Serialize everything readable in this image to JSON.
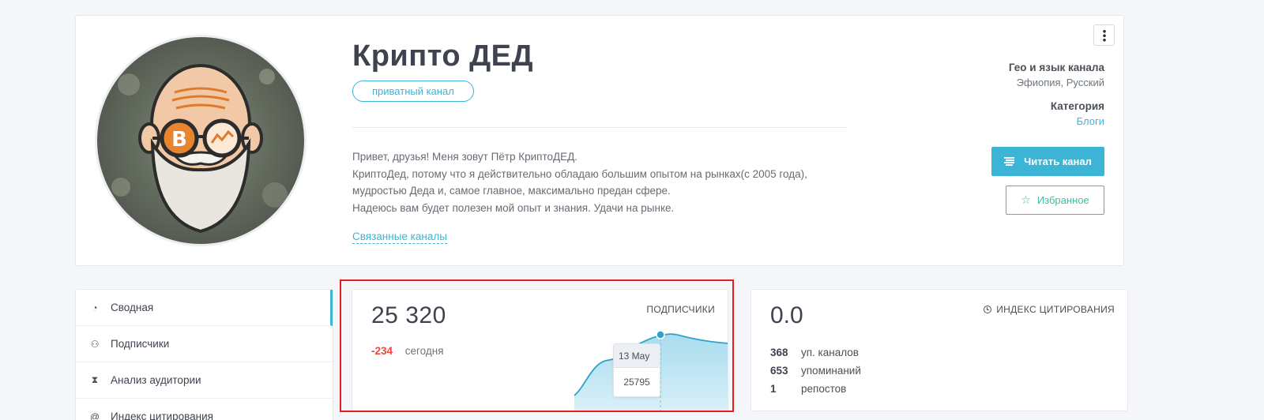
{
  "channel": {
    "title": "Крипто ДЕД",
    "badge": "приватный канал",
    "description": [
      "Привет, друзья! Меня зовут Пётр КриптоДЕД.",
      "КриптоДед, потому что я действительно обладаю большим опытом на рынках(с 2005 года),",
      "мудростью Деда и, самое главное, максимально предан сфере.",
      "Надеюсь вам будет полезен мой опыт и знания. Удачи на рынке."
    ],
    "related_link": "Связанные каналы",
    "geo_label": "Гео и язык канала",
    "geo_value": "Эфиопия, Русский",
    "category_label": "Категория",
    "category_value": "Блоги",
    "read_button": "Читать канал",
    "favorite_button": "Избранное"
  },
  "sidebar": {
    "items": [
      {
        "label": "Сводная",
        "icon": "dashboard-icon",
        "active": true
      },
      {
        "label": "Подписчики",
        "icon": "users-icon"
      },
      {
        "label": "Анализ аудитории",
        "icon": "hourglass-icon"
      },
      {
        "label": "Индекс цитирования",
        "icon": "at-icon"
      }
    ]
  },
  "subscribers": {
    "label": "ПОДПИСЧИКИ",
    "total": "25 320",
    "delta": "-234",
    "delta_label": "сегодня",
    "tooltip_date": "13 May",
    "tooltip_value": "25795"
  },
  "citation": {
    "label": "ИНДЕКС ЦИТИРОВАНИЯ",
    "value": "0.0",
    "stats": [
      {
        "value": "368",
        "label": "уп. каналов"
      },
      {
        "value": "653",
        "label": "упоминаний"
      },
      {
        "value": "1",
        "label": "репостов"
      }
    ]
  },
  "colors": {
    "accent": "#3bb4d6",
    "favorite": "#3bbf9f",
    "negative": "#f0463a",
    "highlight": "#e02020"
  }
}
